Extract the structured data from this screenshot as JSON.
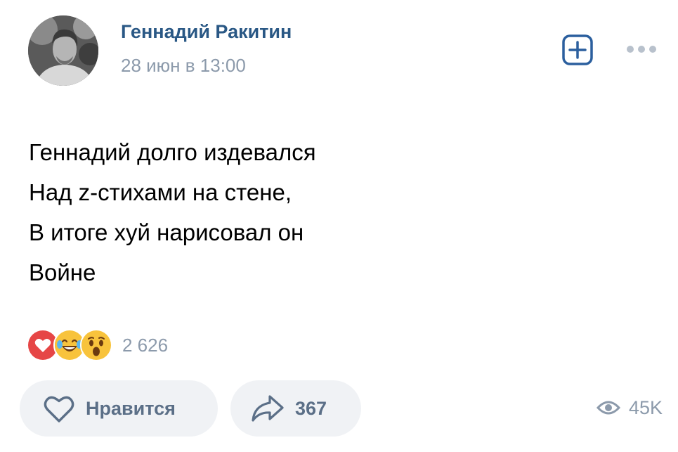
{
  "post": {
    "author": "Геннадий Ракитин",
    "date": "28 июн в 13:00",
    "text_lines": [
      "Геннадий долго издевался",
      "Над z-стихами на стене,",
      "В итоге хуй нарисовал он",
      "Войне"
    ]
  },
  "reactions": {
    "icons": [
      "heart-reaction",
      "laughing-crying-reaction",
      "surprised-reaction"
    ],
    "count": "2 626"
  },
  "actions": {
    "like_label": "Нравится",
    "share_count": "367"
  },
  "views": {
    "count": "45K"
  },
  "colors": {
    "author": "#2a5885",
    "meta": "#8c9aab",
    "button_bg": "#f0f2f5",
    "button_text": "#5b6f87",
    "accent": "#2b5f9e",
    "heart": "#e64646"
  }
}
